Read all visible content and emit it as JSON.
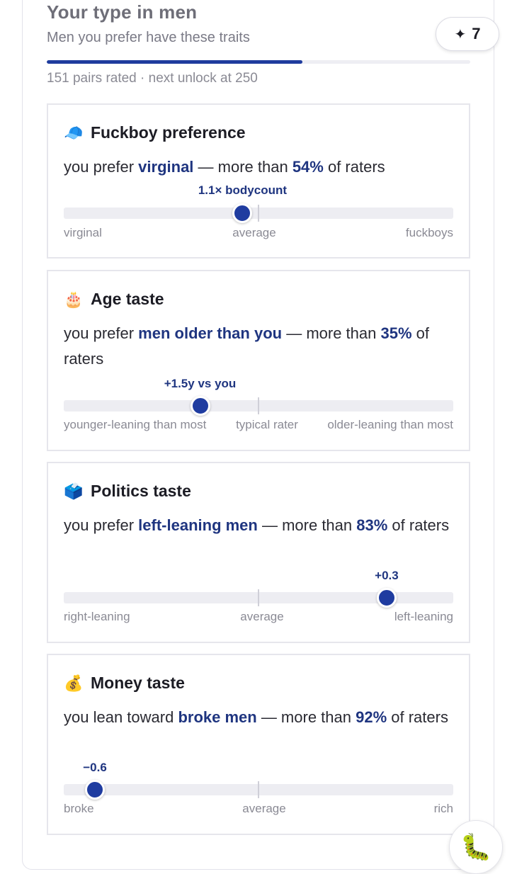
{
  "header": {
    "title": "Your type in men",
    "subtitle": "Men you prefer have these traits",
    "badge_icon": "sparkle-icon",
    "badge_count": "7",
    "progress": 0.604,
    "progress_note": "151 pairs rated · next unlock at 250"
  },
  "cards": [
    {
      "icon": "cap-icon",
      "emoji": "🧢",
      "title": "Fuckboy preference",
      "desc_pre": "you prefer ",
      "desc_strong": "virginal",
      "desc_mid": " — more than ",
      "desc_pct": "54%",
      "desc_post": " of raters",
      "marker_label": "1.1× bodycount",
      "knob_position": 0.459,
      "left_label": "virginal",
      "center_label": "average",
      "right_label": "fuckboys"
    },
    {
      "icon": "cake-icon",
      "emoji": "🎂",
      "title": "Age taste",
      "desc_pre": "you prefer ",
      "desc_strong": "men older than you",
      "desc_mid": " — more than ",
      "desc_pct": "35%",
      "desc_post": " of raters",
      "marker_label": "+1.5y vs you",
      "knob_position": 0.35,
      "left_label": "younger-leaning than most",
      "center_label": "typical rater",
      "right_label": "older-leaning than most"
    },
    {
      "icon": "ballot-box-icon",
      "emoji": "🗳️",
      "title": "Politics taste",
      "desc_pre": "you prefer ",
      "desc_strong": "left-leaning men",
      "desc_mid": " — more than ",
      "desc_pct": "83%",
      "desc_post": " of raters",
      "marker_label": "+0.3",
      "knob_position": 0.829,
      "left_label": "right-leaning",
      "center_label": "average",
      "right_label": "left-leaning"
    },
    {
      "icon": "money-bag-icon",
      "emoji": "💰",
      "title": "Money taste",
      "desc_pre": "you lean toward ",
      "desc_strong": "broke men",
      "desc_mid": " — more than ",
      "desc_pct": "92%",
      "desc_post": " of raters",
      "marker_label": "−0.6",
      "knob_position": 0.08,
      "left_label": "broke",
      "center_label": "average",
      "right_label": "rich"
    }
  ],
  "fab_icon": "bug-icon",
  "fab_emoji": "🐛"
}
